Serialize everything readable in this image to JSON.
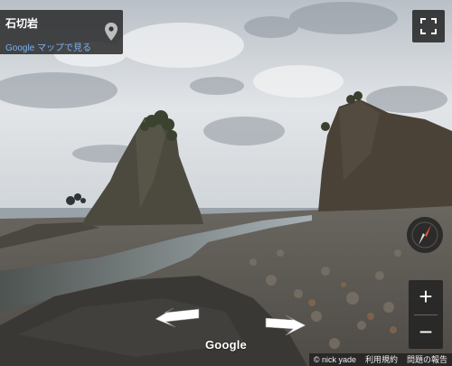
{
  "info_card": {
    "place_name": "石切岩",
    "maps_link": "Google マップで見る"
  },
  "controls": {
    "zoom_in": "+",
    "zoom_out": "−"
  },
  "watermark": "Google",
  "footer": {
    "copyright": "© nick yade",
    "terms": "利用規約",
    "report": "問題の報告"
  },
  "icons": {
    "pin": "map-pin-icon",
    "fullscreen": "fullscreen-icon",
    "compass": "compass-icon"
  },
  "colors": {
    "link": "#7ab2f3",
    "panel": "#222222",
    "compass_north": "#e8533f"
  }
}
